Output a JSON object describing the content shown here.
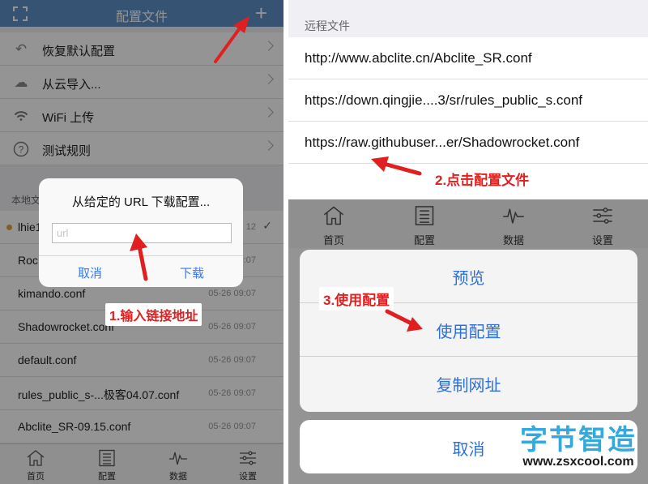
{
  "left": {
    "navbar": {
      "title": "配置文件",
      "plus": "+"
    },
    "menu": [
      {
        "icon": "undo-icon",
        "label": "恢复默认配置"
      },
      {
        "icon": "cloud-icon",
        "label": "从云导入..."
      },
      {
        "icon": "wifi-icon",
        "label": "WiFi 上传"
      },
      {
        "icon": "help-icon",
        "label": "测试规则"
      }
    ],
    "section_header": "本地文",
    "files": [
      {
        "name": "lhie1",
        "time": "12",
        "selected": true
      },
      {
        "name": "Roc",
        "time": "09:07"
      },
      {
        "name": "kimando.conf",
        "time": "05-26 09:07"
      },
      {
        "name": "Shadowrocket.conf",
        "time": "05-26 09:07"
      },
      {
        "name": "default.conf",
        "time": "05-26 09:07"
      },
      {
        "name": "rules_public_s-...极客04.07.conf",
        "time": "05-26 09:07"
      },
      {
        "name": "Abclite_SR-09.15.conf",
        "time": "05-26 09:07"
      }
    ],
    "tabs": [
      "首页",
      "配置",
      "数据",
      "设置"
    ],
    "dialog": {
      "title": "从给定的 URL 下载配置...",
      "input_placeholder": "url",
      "cancel": "取消",
      "download": "下载"
    },
    "annotation": "1.输入链接地址"
  },
  "right": {
    "section_header": "远程文件",
    "remote_files": [
      "http://www.abclite.cn/Abclite_SR.conf",
      "https://down.qingjie....3/sr/rules_public_s.conf",
      "https://raw.githubuser...er/Shadowrocket.conf"
    ],
    "tabs": [
      "首页",
      "配置",
      "数据",
      "设置"
    ],
    "action_sheet": {
      "options": [
        "预览",
        "使用配置",
        "复制网址"
      ],
      "cancel": "取消"
    },
    "annotation_2": "2.点击配置文件",
    "annotation_3": "3.使用配置"
  },
  "watermark": {
    "logo": "字节智造",
    "url": "www.zsxcool.com"
  },
  "colors": {
    "navbar": "#5e8fc7",
    "link_blue": "#2f6fd6",
    "annotation_red": "#e02020",
    "watermark_blue": "#33a9df"
  }
}
